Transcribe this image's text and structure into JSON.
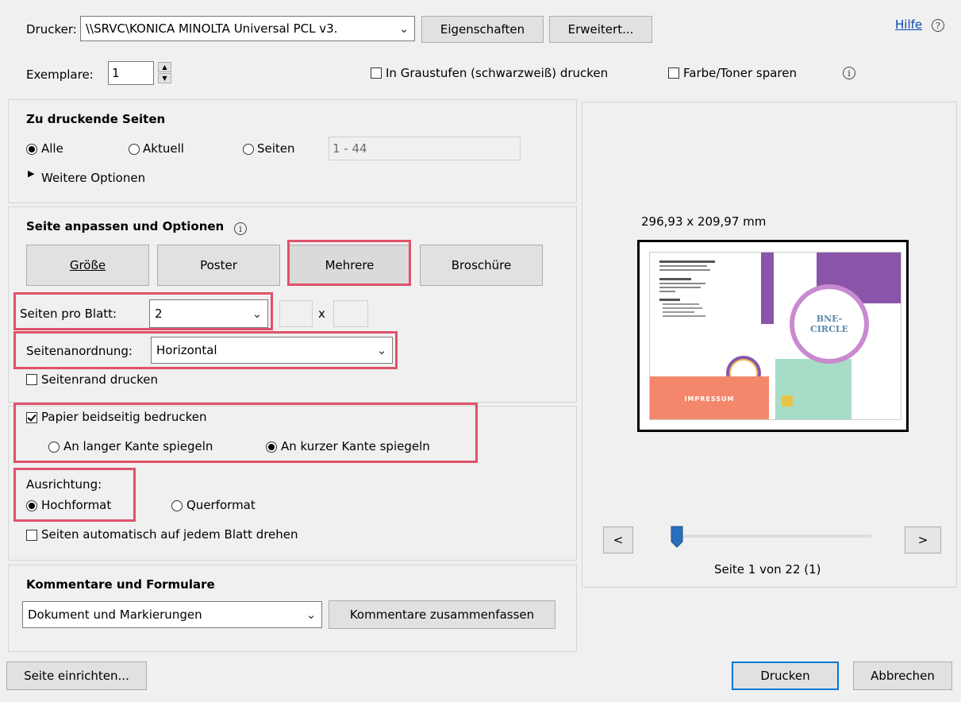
{
  "printer": {
    "label": "Drucker:",
    "value": "\\\\SRVC\\KONICA MINOLTA Universal PCL v3.",
    "properties_btn": "Eigenschaften",
    "advanced_btn": "Erweitert...",
    "help_link": "Hilfe"
  },
  "copies": {
    "label": "Exemplare:",
    "value": "1",
    "grayscale_label": "In Graustufen (schwarzweiß) drucken",
    "grayscale_checked": false,
    "save_toner_label": "Farbe/Toner sparen",
    "save_toner_checked": false
  },
  "pages": {
    "heading": "Zu druckende Seiten",
    "all_label": "Alle",
    "current_label": "Aktuell",
    "pages_label": "Seiten",
    "range_value": "1 - 44",
    "selected": "Alle",
    "more_options": "Weitere Optionen"
  },
  "sizing": {
    "heading": "Seite anpassen und Optionen",
    "size_btn": "Größe",
    "poster_btn": "Poster",
    "multiple_btn": "Mehrere",
    "booklet_btn": "Broschüre",
    "pages_per_sheet_label": "Seiten pro Blatt:",
    "pages_per_sheet_value": "2",
    "times_label": "x",
    "page_order_label": "Seitenanordnung:",
    "page_order_value": "Horizontal",
    "print_border_label": "Seitenrand drucken",
    "print_border_checked": false
  },
  "duplex": {
    "label": "Papier beidseitig bedrucken",
    "checked": true,
    "long_edge_label": "An langer Kante spiegeln",
    "short_edge_label": "An kurzer Kante spiegeln",
    "selected": "short"
  },
  "orientation": {
    "label": "Ausrichtung:",
    "portrait_label": "Hochformat",
    "landscape_label": "Querformat",
    "selected": "portrait",
    "auto_rotate_label": "Seiten automatisch auf jedem Blatt drehen",
    "auto_rotate_checked": false
  },
  "comments": {
    "heading": "Kommentare und Formulare",
    "value": "Dokument und Markierungen",
    "summarize_btn": "Kommentare zusammenfassen"
  },
  "preview": {
    "dimensions": "296,93 x 209,97 mm",
    "prev_btn": "<",
    "next_btn": ">",
    "page_status": "Seite 1 von 22 (1)",
    "slider_position": 0.0,
    "thumb": {
      "impressum": "IMPRESSUM",
      "badge_line1": "BNE-",
      "badge_line2": "CIRCLE"
    }
  },
  "footer": {
    "page_setup_btn": "Seite einrichten...",
    "print_btn": "Drucken",
    "cancel_btn": "Abbrechen"
  },
  "colors": {
    "highlight": "#e0526b",
    "accent": "#0078d7",
    "slider_thumb": "#2a6ebb",
    "thumb_purple": "#8a55a8",
    "thumb_salmon": "#f4876b",
    "thumb_mint": "#a7dcc7",
    "thumb_ring": "#c98ad0"
  }
}
